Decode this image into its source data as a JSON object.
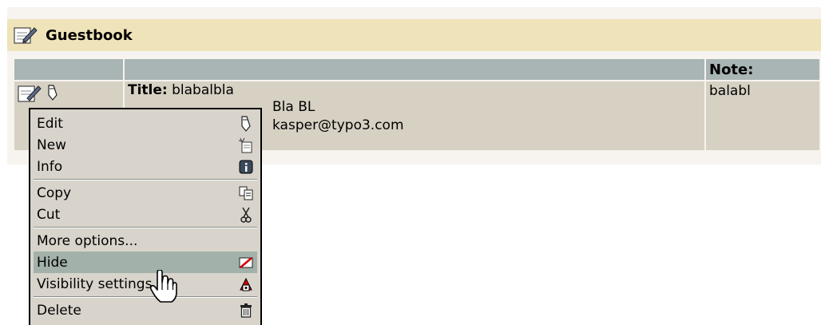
{
  "header": {
    "title": "Guestbook",
    "icon": "guestbook-icon"
  },
  "table": {
    "columns": [
      "",
      "",
      "Note:"
    ],
    "rows": [
      {
        "title_label": "Title:",
        "title_value": "blabalbla",
        "name_value": "Bla BL",
        "email_value": "kasper@typo3.com",
        "note": "balabl"
      }
    ]
  },
  "context_menu": {
    "items": [
      {
        "label": "Edit",
        "icon": "pencil-icon"
      },
      {
        "label": "New",
        "icon": "new-record-icon"
      },
      {
        "label": "Info",
        "icon": "info-icon"
      },
      {
        "label": "Copy",
        "icon": "copy-icon"
      },
      {
        "label": "Cut",
        "icon": "scissors-icon"
      },
      {
        "label": "More options...",
        "icon": ""
      },
      {
        "label": "Hide",
        "icon": "hide-icon",
        "highlighted": true
      },
      {
        "label": "Visibility settings",
        "icon": "visibility-icon"
      },
      {
        "label": "Delete",
        "icon": "trash-icon"
      }
    ]
  },
  "colors": {
    "header_bg": "#efe3b9",
    "col_header_bg": "#a9b4b4",
    "row_bg": "#d7d1c4",
    "menu_bg": "#d8d4cb",
    "menu_highlight": "#a2b1a9"
  }
}
